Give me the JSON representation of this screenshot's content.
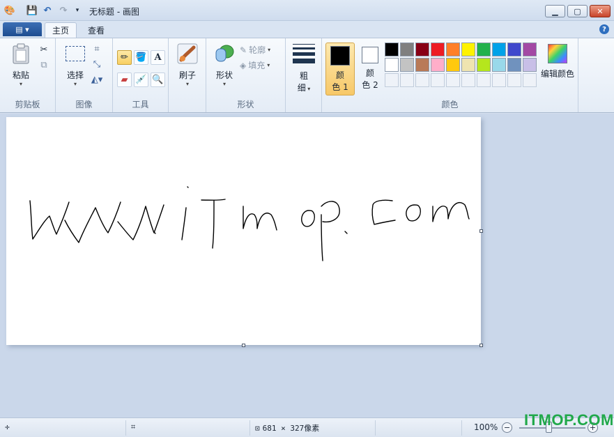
{
  "window": {
    "title": "无标题 - 画图",
    "controls": [
      "minimize",
      "maximize",
      "close"
    ]
  },
  "tabs": [
    {
      "label": "主页",
      "active": true
    },
    {
      "label": "查看",
      "active": false
    }
  ],
  "ribbon": {
    "clipboard": {
      "label": "剪贴板",
      "paste": "粘贴"
    },
    "image": {
      "label": "图像",
      "select": "选择"
    },
    "tools": {
      "label": "工具"
    },
    "brushes": {
      "label": "刷子"
    },
    "shapes": {
      "label": "形状",
      "shape_button": "形状",
      "outline": "轮廓",
      "fill": "填充"
    },
    "size": {
      "label_line1": "粗",
      "label_line2": "细"
    },
    "colors": {
      "label": "颜色",
      "color1": {
        "line1": "颜",
        "line2": "色 1",
        "value": "#000000"
      },
      "color2": {
        "line1": "颜",
        "line2": "色 2",
        "value": "#ffffff"
      },
      "edit_colors": "编辑颜色",
      "palette_row1": [
        "#000000",
        "#7f7f7f",
        "#880015",
        "#ed1c24",
        "#ff7f27",
        "#fff200",
        "#22b14c",
        "#00a2e8",
        "#3f48cc",
        "#a349a4"
      ],
      "palette_row2": [
        "#ffffff",
        "#c3c3c3",
        "#b97a57",
        "#ffaec9",
        "#ffc90e",
        "#efe4b0",
        "#b5e61d",
        "#99d9ea",
        "#7092be",
        "#c8bfe7"
      ]
    }
  },
  "canvas": {
    "drawing_text": "www.iTmop.com"
  },
  "statusbar": {
    "size": "681 × 327像素",
    "zoom": "100%"
  },
  "watermark": "ITMOP.COM"
}
